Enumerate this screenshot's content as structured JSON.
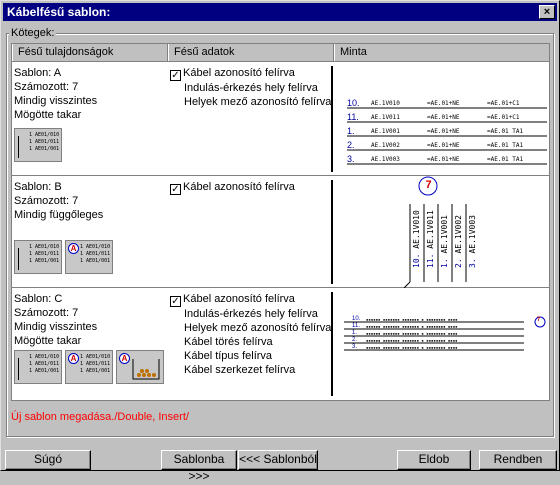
{
  "window": {
    "title": "Kábelfésű sablon:",
    "close_label": "×"
  },
  "group": {
    "label": "Kötegek:"
  },
  "columns": [
    "Fésű tulajdonságok",
    "Fésű adatok",
    "Minta"
  ],
  "rows": [
    {
      "props": [
        "Sablon:  A",
        "Számozott: 7",
        "Mindig visszintes",
        "Mögötte takar"
      ],
      "checkbox_label": "Kábel azonosító felírva",
      "extra": [
        "Indulás-érkezés hely felírva",
        "Helyek mező azonosító felírva"
      ],
      "thumb_lines": [
        "1 AE01/010",
        "1 AE01/011",
        "1 AE01/001"
      ],
      "sample": {
        "nums": [
          "10.",
          "11.",
          "1.",
          "2.",
          "3."
        ],
        "cols": [
          [
            "AE.1V010",
            "=AE.01+NE",
            "=AE.01+C1"
          ],
          [
            "AE.1V011",
            "=AE.01+NE",
            "=AE.01+C1"
          ],
          [
            "AE.1V001",
            "=AE.01+NE",
            "=AE.01 TA1"
          ],
          [
            "AE.1V002",
            "=AE.01+NE",
            "=AE.01 TA1"
          ],
          [
            "AE.1V003",
            "=AE.01+NE",
            "=AE.01 TA1"
          ]
        ]
      }
    },
    {
      "props": [
        "Sablon:  B",
        "Számozott: 7",
        "Mindig függőleges"
      ],
      "checkbox_label": "Kábel azonosító felírva",
      "extra": [],
      "thumb_lines": [
        "1 AE01/010",
        "1 AE01/011",
        "1 AE01/001"
      ],
      "badge": "A",
      "circle": "7",
      "sample_nums": [
        "10.",
        "11.",
        "1.",
        "2.",
        "3."
      ],
      "sample_ids": [
        "AE.1V010",
        "AE.1V011",
        "AE.1V001",
        "AE.1V002",
        "AE.1V003"
      ]
    },
    {
      "props": [
        "Sablon:  C",
        "Számozott: 7",
        "Mindig visszintes",
        "Mögötte takar"
      ],
      "checkbox_label": "Kábel azonosító felírva",
      "extra": [
        "Indulás-érkezés hely felírva",
        "Helyek mező azonosító felírva",
        "Kábel törés felírva",
        "Kábel típus felírva",
        "Kábel szerkezet felírva"
      ],
      "thumb_lines": [
        "1 AE01/010",
        "1 AE01/011",
        "1 AE01/001"
      ],
      "badge": "A",
      "circle": "7",
      "sample_nums": [
        "10.",
        "11.",
        "1.",
        "2.",
        "3."
      ]
    }
  ],
  "status": "Új sablon megadása./Double, Insert/",
  "buttons": {
    "help": "Súgó",
    "to_template": "Sablonba >>>",
    "from_template": "<<< Sablonból",
    "delete": "Eldob",
    "ok": "Rendben"
  }
}
